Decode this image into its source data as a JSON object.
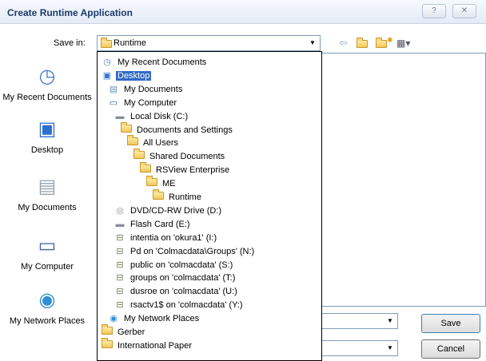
{
  "window": {
    "title": "Create Runtime Application",
    "help_label": "?",
    "close_label": "✕"
  },
  "save_in": {
    "label": "Save in:",
    "value": "Runtime"
  },
  "places": [
    {
      "label": "My Recent Documents",
      "icon": "recent-documents-icon"
    },
    {
      "label": "Desktop",
      "icon": "desktop-icon"
    },
    {
      "label": "My Documents",
      "icon": "my-documents-icon"
    },
    {
      "label": "My Computer",
      "icon": "my-computer-icon"
    },
    {
      "label": "My Network Places",
      "icon": "network-places-icon"
    }
  ],
  "dropdown_items": [
    {
      "label": "My Recent Documents",
      "icon": "recent-documents-icon",
      "indent": 0,
      "selected": false
    },
    {
      "label": "Desktop",
      "icon": "desktop-icon",
      "indent": 0,
      "selected": true
    },
    {
      "label": "My Documents",
      "icon": "my-documents-icon",
      "indent": 1,
      "selected": false
    },
    {
      "label": "My Computer",
      "icon": "my-computer-icon",
      "indent": 1,
      "selected": false
    },
    {
      "label": "Local Disk (C:)",
      "icon": "drive-icon",
      "indent": 2,
      "selected": false
    },
    {
      "label": "Documents and Settings",
      "icon": "folder-icon",
      "indent": 3,
      "selected": false
    },
    {
      "label": "All Users",
      "icon": "folder-icon",
      "indent": 4,
      "selected": false
    },
    {
      "label": "Shared Documents",
      "icon": "folder-icon",
      "indent": 5,
      "selected": false
    },
    {
      "label": "RSView Enterprise",
      "icon": "folder-icon",
      "indent": 6,
      "selected": false
    },
    {
      "label": "ME",
      "icon": "folder-icon",
      "indent": 7,
      "selected": false
    },
    {
      "label": "Runtime",
      "icon": "folder-icon",
      "indent": 8,
      "selected": false
    },
    {
      "label": "DVD/CD-RW Drive (D:)",
      "icon": "dvd-drive-icon",
      "indent": 2,
      "selected": false
    },
    {
      "label": "Flash Card (E:)",
      "icon": "drive-icon",
      "indent": 2,
      "selected": false
    },
    {
      "label": "intentia on 'okura1' (I:)",
      "icon": "network-drive-icon",
      "indent": 2,
      "selected": false
    },
    {
      "label": "Pd on 'Colmacdata\\Groups' (N:)",
      "icon": "network-drive-icon",
      "indent": 2,
      "selected": false
    },
    {
      "label": "public on 'colmacdata' (S:)",
      "icon": "network-drive-icon",
      "indent": 2,
      "selected": false
    },
    {
      "label": "groups on 'colmacdata' (T:)",
      "icon": "network-drive-icon",
      "indent": 2,
      "selected": false
    },
    {
      "label": "dusroe on 'colmacdata' (U:)",
      "icon": "network-drive-icon",
      "indent": 2,
      "selected": false
    },
    {
      "label": "rsactv1$ on 'colmacdata' (Y:)",
      "icon": "network-drive-icon",
      "indent": 2,
      "selected": false
    },
    {
      "label": "My Network Places",
      "icon": "network-places-icon",
      "indent": 1,
      "selected": false
    },
    {
      "label": "Gerber",
      "icon": "folder-icon",
      "indent": 0,
      "selected": false
    },
    {
      "label": "International Paper",
      "icon": "folder-icon",
      "indent": 0,
      "selected": false
    }
  ],
  "buttons": {
    "save": "Save",
    "cancel": "Cancel"
  }
}
